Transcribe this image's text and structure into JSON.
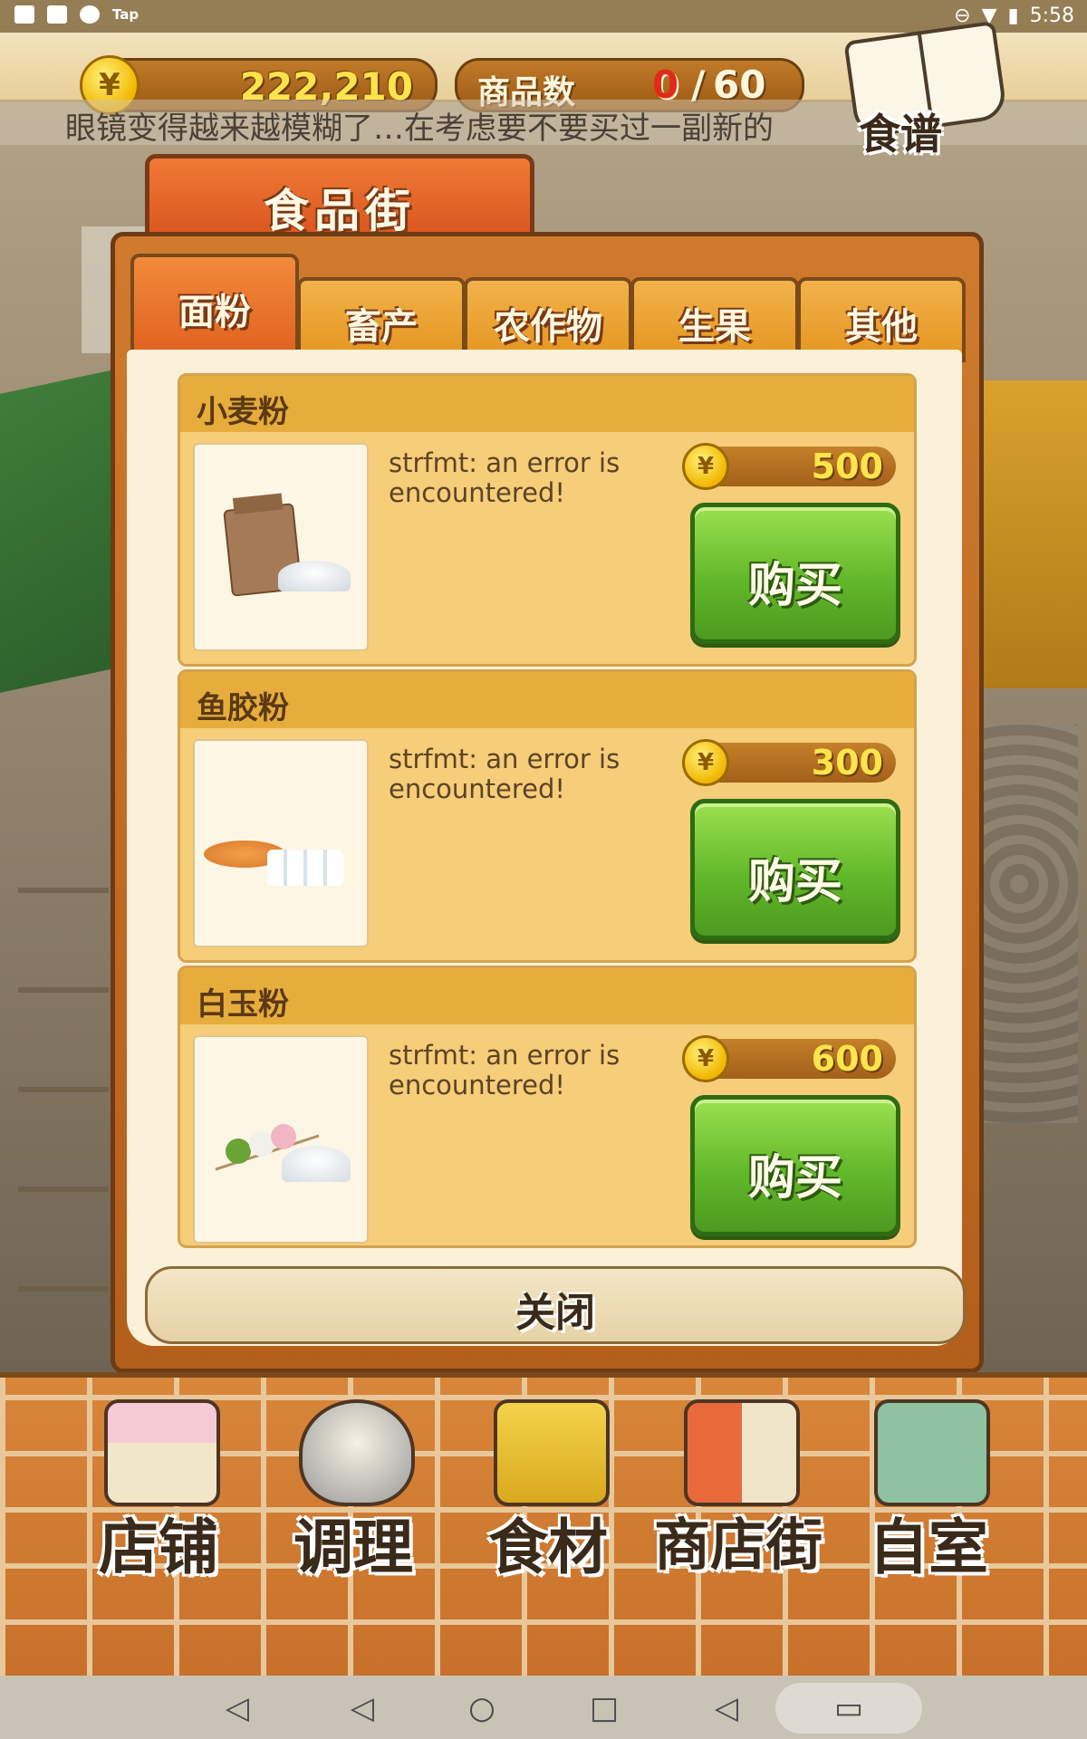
{
  "status_bar": {
    "app_label": "Tap",
    "time": "5:58"
  },
  "hud": {
    "money": "222,210",
    "currency_symbol": "¥",
    "item_count_label": "商品数",
    "item_count_current": "0",
    "item_count_sep": "/",
    "item_count_max": "60",
    "recipe_label": "食谱"
  },
  "ticker": {
    "text": "眼镜变得越来越模糊了…在考虑要不要买过一副新的"
  },
  "store": {
    "title": "食品街",
    "tabs": [
      {
        "label": "面粉",
        "active": true
      },
      {
        "label": "畜产",
        "active": false
      },
      {
        "label": "农作物",
        "active": false
      },
      {
        "label": "生果",
        "active": false
      },
      {
        "label": "其他",
        "active": false
      }
    ],
    "items": [
      {
        "name": "小麦粉",
        "description": "strfmt: an error is encountered!",
        "price": "500",
        "buy_label": "购买"
      },
      {
        "name": "鱼胶粉",
        "description": "strfmt: an error is encountered!",
        "price": "300",
        "buy_label": "购买"
      },
      {
        "name": "白玉粉",
        "description": "strfmt: an error is encountered!",
        "price": "600",
        "buy_label": "购买"
      }
    ],
    "close_label": "关闭"
  },
  "bottom_nav": [
    {
      "label": "店铺",
      "icon": "cake-icon"
    },
    {
      "label": "调理",
      "icon": "mixing-bowl-icon"
    },
    {
      "label": "食材",
      "icon": "ingredient-bag-icon"
    },
    {
      "label": "商店街",
      "icon": "shop-street-icon"
    },
    {
      "label": "自室",
      "icon": "staff-room-icon"
    }
  ],
  "colors": {
    "accent_orange": "#e0601f",
    "buy_green": "#62b82a",
    "price_yellow": "#ffe54a",
    "count_red": "#e02a1a"
  }
}
